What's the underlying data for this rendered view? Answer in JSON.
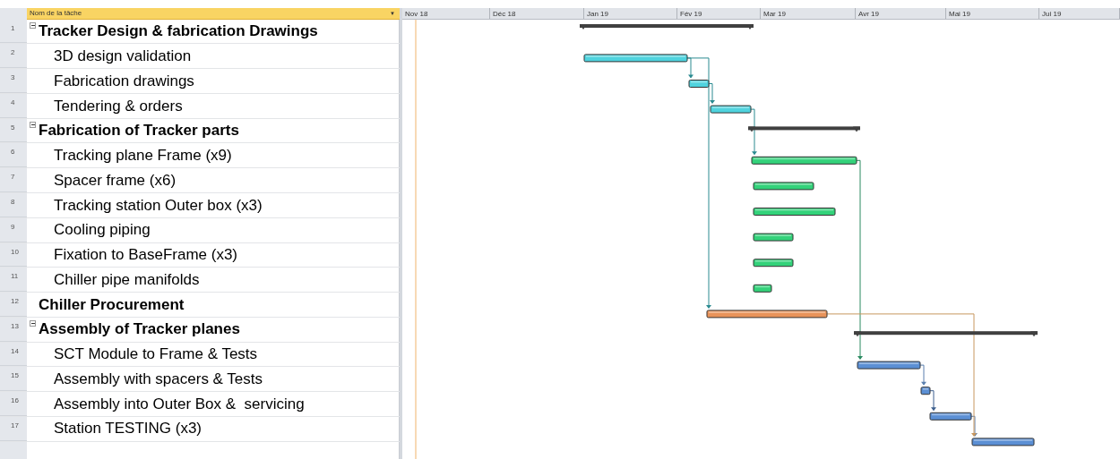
{
  "table": {
    "column_header": "Nom de la tâche",
    "dropdown": "▼"
  },
  "timeline": {
    "months": [
      "Nov 18",
      "Déc 18",
      "Jan 19",
      "Fév 19",
      "Mar 19",
      "Avr 19",
      "Mai 19",
      "Jui 19"
    ]
  },
  "tasks": [
    {
      "number": "1",
      "name": "Tracker Design & fabrication Drawings",
      "kind": "summary",
      "expanded": true,
      "color": "#404040",
      "children": [
        {
          "number": "2",
          "name": "3D design validation",
          "kind": "task",
          "color": "#4fd3de"
        },
        {
          "number": "3",
          "name": "Fabrication drawings",
          "kind": "task",
          "color": "#4fd3de"
        },
        {
          "number": "4",
          "name": "Tendering & orders",
          "kind": "task",
          "color": "#4fd3de"
        }
      ]
    },
    {
      "number": "5",
      "name": "Fabrication of Tracker parts",
      "kind": "summary",
      "expanded": true,
      "color": "#404040",
      "children": [
        {
          "number": "6",
          "name": "Tracking plane Frame (x9)",
          "kind": "task",
          "color": "#33d27a"
        },
        {
          "number": "7",
          "name": "Spacer frame (x6)",
          "kind": "task",
          "color": "#33d27a"
        },
        {
          "number": "8",
          "name": "Tracking station Outer box (x3)",
          "kind": "task",
          "color": "#33d27a"
        },
        {
          "number": "9",
          "name": "Cooling piping",
          "kind": "task",
          "color": "#33d27a"
        },
        {
          "number": "10",
          "name": "Fixation to BaseFrame (x3)",
          "kind": "task",
          "color": "#33d27a"
        },
        {
          "number": "11",
          "name": "Chiller pipe manifolds",
          "kind": "task",
          "color": "#33d27a"
        }
      ]
    },
    {
      "number": "12",
      "name": "Chiller Procurement",
      "kind": "standalone",
      "color": "#e8935a"
    },
    {
      "number": "13",
      "name": "Assembly of Tracker planes",
      "kind": "summary",
      "expanded": true,
      "color": "#404040",
      "children": [
        {
          "number": "14",
          "name": "SCT Module to Frame & Tests",
          "kind": "task",
          "color": "#5b8fd4"
        },
        {
          "number": "15",
          "name": "Assembly with spacers & Tests",
          "kind": "task",
          "color": "#5b8fd4"
        },
        {
          "number": "16",
          "name": "Assembly into Outer Box &  servicing",
          "kind": "task",
          "color": "#5b8fd4"
        },
        {
          "number": "17",
          "name": "Station TESTING (x3)",
          "kind": "task",
          "color": "#5b8fd4"
        }
      ]
    }
  ]
}
